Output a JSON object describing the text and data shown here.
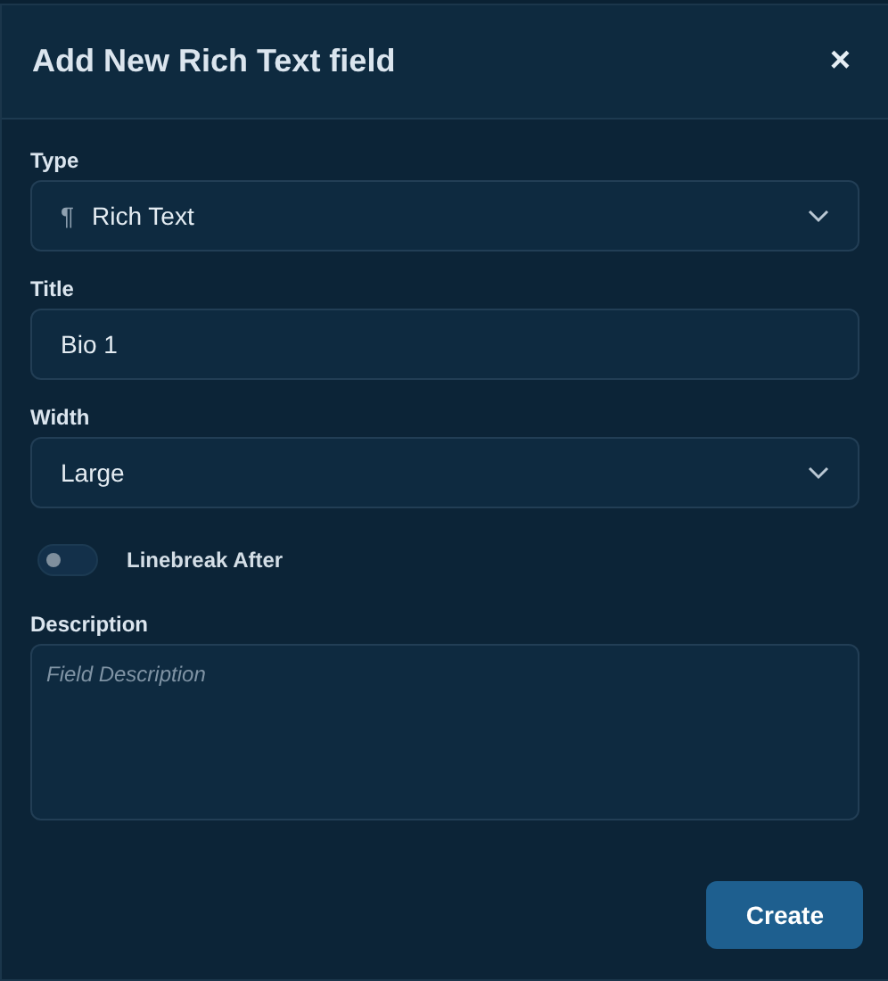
{
  "dialog": {
    "title": "Add New Rich Text field",
    "close": "×"
  },
  "fields": [
    {
      "kind": "select",
      "label": "Type",
      "glyph": "¶",
      "value": "Rich Text"
    },
    {
      "kind": "text",
      "label": "Title",
      "value": "Bio 1"
    },
    {
      "kind": "select",
      "label": "Width",
      "value": "Large"
    },
    {
      "kind": "toggle",
      "label": "Linebreak After",
      "on": false
    },
    {
      "kind": "textarea",
      "label": "Description",
      "placeholder": "Field Description"
    }
  ],
  "buttons": [
    "Create"
  ]
}
